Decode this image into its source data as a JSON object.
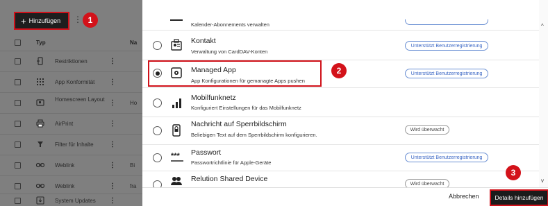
{
  "left_panel": {
    "add_button": "Hinzufügen",
    "header_type": "Typ",
    "header_name": "Na",
    "rows": [
      {
        "icon": "restriction-icon",
        "name": "Restriktionen",
        "col": ""
      },
      {
        "icon": "apps-grid-icon",
        "name": "App Konformität",
        "col": ""
      },
      {
        "icon": "homescreen-icon",
        "name": "Homescreen Layout",
        "col": "Ho"
      },
      {
        "icon": "printer-icon",
        "name": "AirPrint",
        "col": ""
      },
      {
        "icon": "filter-icon",
        "name": "Filter für Inhalte",
        "col": ""
      },
      {
        "icon": "link-icon",
        "name": "Weblink",
        "col": "Bi"
      },
      {
        "icon": "link-icon",
        "name": "Weblink",
        "col": "fra"
      },
      {
        "icon": "download-icon",
        "name": "System Updates",
        "col": ""
      }
    ]
  },
  "annotations": {
    "step1": "1",
    "step2": "2",
    "step3": "3"
  },
  "modal": {
    "partial_top_desc": "Kalender-Abonnements verwalten",
    "profiles": [
      {
        "icon": "contact-card-icon",
        "title": "Kontakt",
        "desc": "Verwaltung von CardDAV-Konten",
        "badge": "Unterstützt Benutzerregistrierung",
        "badge_style": "blue",
        "selected": false
      },
      {
        "icon": "managed-app-icon",
        "title": "Managed App",
        "desc": "App Konfigurationen für gemanagte Apps pushen",
        "badge": "Unterstützt Benutzerregistrierung",
        "badge_style": "blue",
        "selected": true
      },
      {
        "icon": "signal-bars-icon",
        "title": "Mobilfunknetz",
        "desc": "Konfiguriert Einstellungen für das Mobilfunknetz",
        "badge": "",
        "badge_style": "",
        "selected": false
      },
      {
        "icon": "lockscreen-icon",
        "title": "Nachricht auf Sperrbildschirm",
        "desc": "Beliebigen Text auf dem Sperrbildschirm konfigurieren.",
        "badge": "Wird überwacht",
        "badge_style": "gray",
        "selected": false
      },
      {
        "icon": "password-icon",
        "title": "Passwort",
        "desc": "Passwortrichtlinie für Apple-Geräte",
        "badge": "Unterstützt Benutzerregistrierung",
        "badge_style": "blue",
        "selected": false
      },
      {
        "icon": "shared-device-icon",
        "title": "Relution Shared Device",
        "desc": "",
        "badge": "Wird überwacht",
        "badge_style": "gray",
        "selected": false
      }
    ],
    "cancel_label": "Abbrechen",
    "details_label": "Details hinzufügen"
  }
}
